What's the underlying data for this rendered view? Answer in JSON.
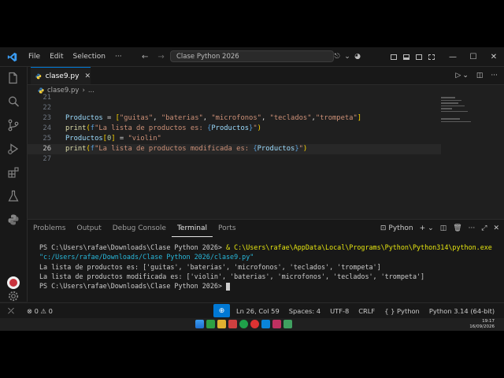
{
  "titlebar": {
    "menus": [
      "File",
      "Edit",
      "Selection",
      "···"
    ],
    "command_center": "Clase Python 2026"
  },
  "editor": {
    "tab_label": "clase9.py",
    "breadcrumb": [
      "clase9.py",
      "..."
    ],
    "line_numbers": [
      "21",
      "22",
      "23",
      "24",
      "25",
      "26",
      "27"
    ]
  },
  "panel": {
    "tabs": [
      "Problems",
      "Output",
      "Debug Console",
      "Terminal",
      "Ports"
    ],
    "active_tab": "Terminal",
    "terminal_profile": "Python",
    "terminal_lines": {
      "prompt1": "PS C:\\Users\\rafae\\Downloads\\Clase Python 2026> ",
      "amp": "& ",
      "exe": "C:\\Users\\rafae\\AppData\\Local\\Programs\\Python\\Python314\\python.exe",
      "script_path": "\"c:/Users/rafae/Downloads/Clase Python 2026/clase9.py\"",
      "out1": "La lista de productos es: ['guitas', 'baterias', 'microfonos', 'teclados', 'trompeta']",
      "out2": "La lista de productos modificada es: ['violin', 'baterias', 'microfonos', 'teclados', 'trompeta']",
      "prompt2": "PS C:\\Users\\rafae\\Downloads\\Clase Python 2026>"
    }
  },
  "statusbar": {
    "problems": "0",
    "warnings": "0",
    "position": "Ln 26, Col 59",
    "spaces": "Spaces: 4",
    "encoding": "UTF-8",
    "eol": "CRLF",
    "language_braces": "{ }",
    "language": "Python",
    "interpreter": "Python 3.14 (64-bit)"
  },
  "taskbar": {
    "time": "19:17",
    "date": "16/09/2026"
  },
  "colors": {
    "accent": "#0078d4",
    "editor_bg": "#1f1f1f",
    "chrome_bg": "#181818"
  }
}
